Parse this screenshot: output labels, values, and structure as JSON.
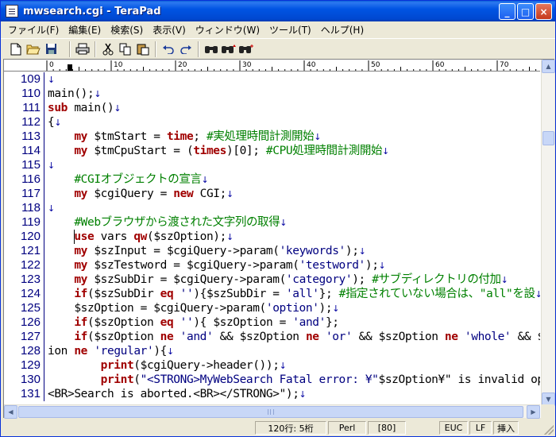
{
  "window": {
    "title": "mwsearch.cgi - TeraPad"
  },
  "title_buttons": {
    "minimize": "_",
    "maximize": "□",
    "close": "×"
  },
  "menu": [
    "ファイル(F)",
    "編集(E)",
    "検索(S)",
    "表示(V)",
    "ウィンドウ(W)",
    "ツール(T)",
    "ヘルプ(H)"
  ],
  "toolbar": {
    "icons": [
      "new-file-icon",
      "open-folder-icon",
      "save-icon",
      "print-icon",
      "cut-icon",
      "copy-icon",
      "paste-icon",
      "undo-icon",
      "redo-icon",
      "find-icon",
      "find-previous-icon",
      "find-next-icon"
    ]
  },
  "ruler": {
    "labels": [
      "0",
      "10",
      "20",
      "30",
      "40",
      "50",
      "60",
      "70"
    ]
  },
  "editor": {
    "line_end_mark": "↓",
    "lines": [
      {
        "no": "109",
        "text": ""
      },
      {
        "no": "110",
        "text": "main();"
      },
      {
        "no": "111",
        "text": "sub main()"
      },
      {
        "no": "112",
        "text": "{"
      },
      {
        "no": "113",
        "text": "    my $tmStart = time; #実処理時間計測開始"
      },
      {
        "no": "114",
        "text": "    my $tmCpuStart = (times)[0]; #CPU処理時間計測開始"
      },
      {
        "no": "115",
        "text": ""
      },
      {
        "no": "116",
        "text": "    #CGIオブジェクトの宣言"
      },
      {
        "no": "117",
        "text": "    my $cgiQuery = new CGI;"
      },
      {
        "no": "118",
        "text": ""
      },
      {
        "no": "119",
        "text": "    #Webブラウザから渡された文字列の取得"
      },
      {
        "no": "120",
        "text": "    use vars qw($szOption);"
      },
      {
        "no": "121",
        "text": "    my $szInput = $cgiQuery->param('keywords');"
      },
      {
        "no": "122",
        "text": "    my $szTestword = $cgiQuery->param('testword');"
      },
      {
        "no": "123",
        "text": "    my $szSubDir = $cgiQuery->param('category'); #サブディレクトリの付加"
      },
      {
        "no": "124",
        "text": "    if($szSubDir eq ''){$szSubDir = 'all'}; #指定されていない場合は、\"all\"を設"
      },
      {
        "no": "125",
        "text": "    $szOption = $cgiQuery->param('option');"
      },
      {
        "no": "126",
        "text": "    if($szOption eq ''){ $szOption = 'and'};"
      },
      {
        "no": "127",
        "text": "    if($szOption ne 'and' && $szOption ne 'or' && $szOption ne 'whole' && $szO"
      },
      {
        "no": "128",
        "text": "ion ne 'regular'){"
      },
      {
        "no": "129",
        "text": "        print($cgiQuery->header());"
      },
      {
        "no": "130",
        "text": "        print(\"<STRONG>MyWebSearch Fatal error: ¥\"$szOption¥\" is invalid optic"
      },
      {
        "no": "131",
        "text": "<BR>Search is aborted.<BR></STRONG>\");"
      }
    ]
  },
  "status": {
    "position": "120行:   5桁",
    "language": "Perl",
    "width": "[80]",
    "encoding": "EUC",
    "line_ending": "LF",
    "mode": "挿入"
  }
}
